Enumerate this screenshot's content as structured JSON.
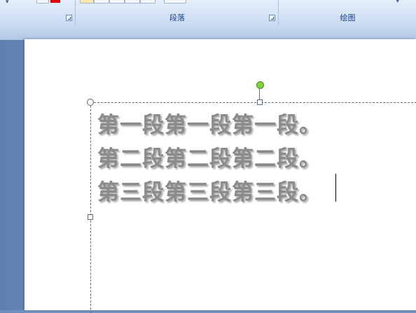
{
  "ribbon": {
    "groups": [
      {
        "label": ""
      },
      {
        "label": "段落"
      },
      {
        "label": "绘图"
      }
    ]
  },
  "textbox": {
    "lines": [
      "第一段第一段第一段。",
      "第二段第二段第二段。",
      "第三段第三段第三段。"
    ]
  },
  "colors": {
    "font_color_swatch": "#e00000",
    "rotation_handle": "#7ed33a",
    "text": "#8b8b8b"
  }
}
